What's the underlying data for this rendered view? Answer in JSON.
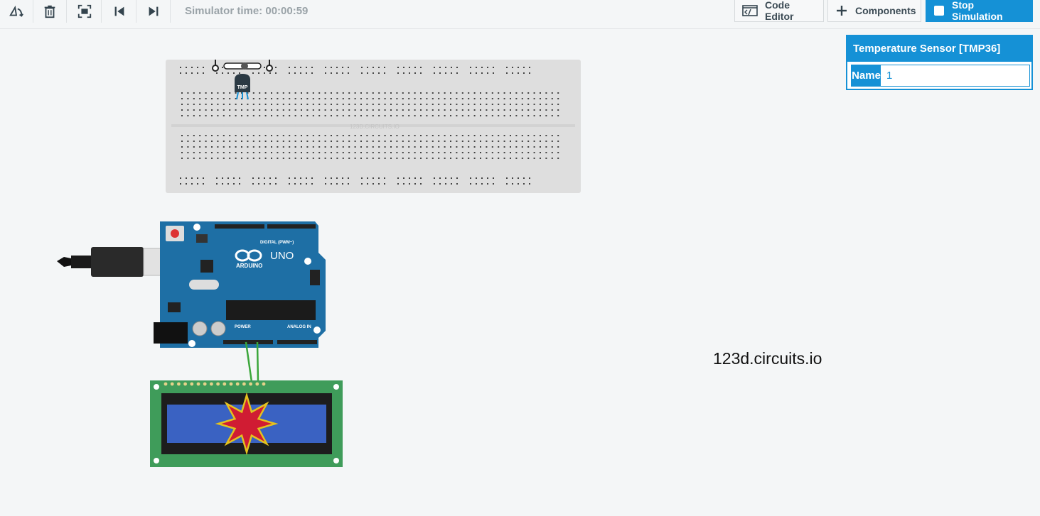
{
  "toolbar": {
    "simulator_time_label": "Simulator time: 00:00:59",
    "code_editor_label": "Code Editor",
    "components_label": "Components",
    "stop_simulation_label": "Stop Simulation"
  },
  "inspector": {
    "title": "Temperature Sensor [TMP36]",
    "name_label": "Name",
    "name_value": "1"
  },
  "canvas": {
    "watermark": "123d.circuits.io",
    "breadboard_watermark": "123D.CIRCUITS.IO",
    "sensor_label": "TMP",
    "arduino_brand": "ARDUINO",
    "arduino_model": "UNO",
    "digital_label": "DIGITAL (PWM~)",
    "power_label": "POWER",
    "analog_label": "ANALOG IN"
  },
  "colors": {
    "accent": "#1591d6",
    "arduino_board": "#1e6fa5",
    "lcd_board": "#3f9c5a",
    "lcd_screen": "#3a62c2",
    "wire": "#3aa63a"
  }
}
